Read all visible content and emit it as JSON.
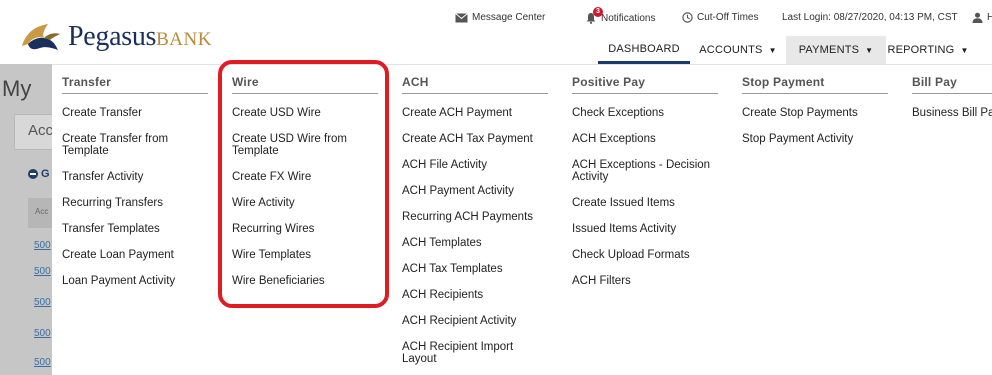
{
  "brand": {
    "name_primary": "Pegasus",
    "name_secondary": "BANK"
  },
  "utility": {
    "message_center": "Message Center",
    "notifications": "Notifications",
    "notifications_count": "3",
    "cutoff_times": "Cut-Off Times",
    "last_login": "Last Login: 08/27/2020, 04:13 PM, CST",
    "user_initial": "H"
  },
  "nav": {
    "dashboard": "DASHBOARD",
    "accounts": "ACCOUNTS",
    "payments": "PAYMENTS",
    "reporting": "REPORTING"
  },
  "background": {
    "title": "My",
    "tab": "Acc",
    "group": "G",
    "col_header": "Acc",
    "rows": [
      "500",
      "500",
      "500",
      "500",
      "500"
    ]
  },
  "menu": {
    "transfer": {
      "heading": "Transfer",
      "items": [
        "Create Transfer",
        "Create Transfer from Template",
        "Transfer Activity",
        "Recurring Transfers",
        "Transfer Templates",
        "Create Loan Payment",
        "Loan Payment Activity"
      ]
    },
    "wire": {
      "heading": "Wire",
      "items": [
        "Create USD Wire",
        "Create USD Wire from Template",
        "Create FX Wire",
        "Wire Activity",
        "Recurring Wires",
        "Wire Templates",
        "Wire Beneficiaries"
      ]
    },
    "ach": {
      "heading": "ACH",
      "items": [
        "Create ACH Payment",
        "Create ACH Tax Payment",
        "ACH File Activity",
        "ACH Payment Activity",
        "Recurring ACH Payments",
        "ACH Templates",
        "ACH Tax Templates",
        "ACH Recipients",
        "ACH Recipient Activity",
        "ACH Recipient Import Layout"
      ]
    },
    "positive_pay": {
      "heading": "Positive Pay",
      "items": [
        "Check Exceptions",
        "ACH Exceptions",
        "ACH Exceptions - Decision Activity",
        "Create Issued Items",
        "Issued Items Activity",
        "Check Upload Formats",
        "ACH Filters"
      ]
    },
    "stop_payment": {
      "heading": "Stop Payment",
      "items": [
        "Create Stop Payments",
        "Stop Payment Activity"
      ]
    },
    "bill_pay": {
      "heading": "Bill Pay",
      "items": [
        "Business Bill Pay"
      ]
    }
  },
  "colors": {
    "brand_navy": "#1b2f5c",
    "brand_gold": "#b88a3a",
    "highlight": "#e11b22",
    "badge": "#d0182b"
  }
}
